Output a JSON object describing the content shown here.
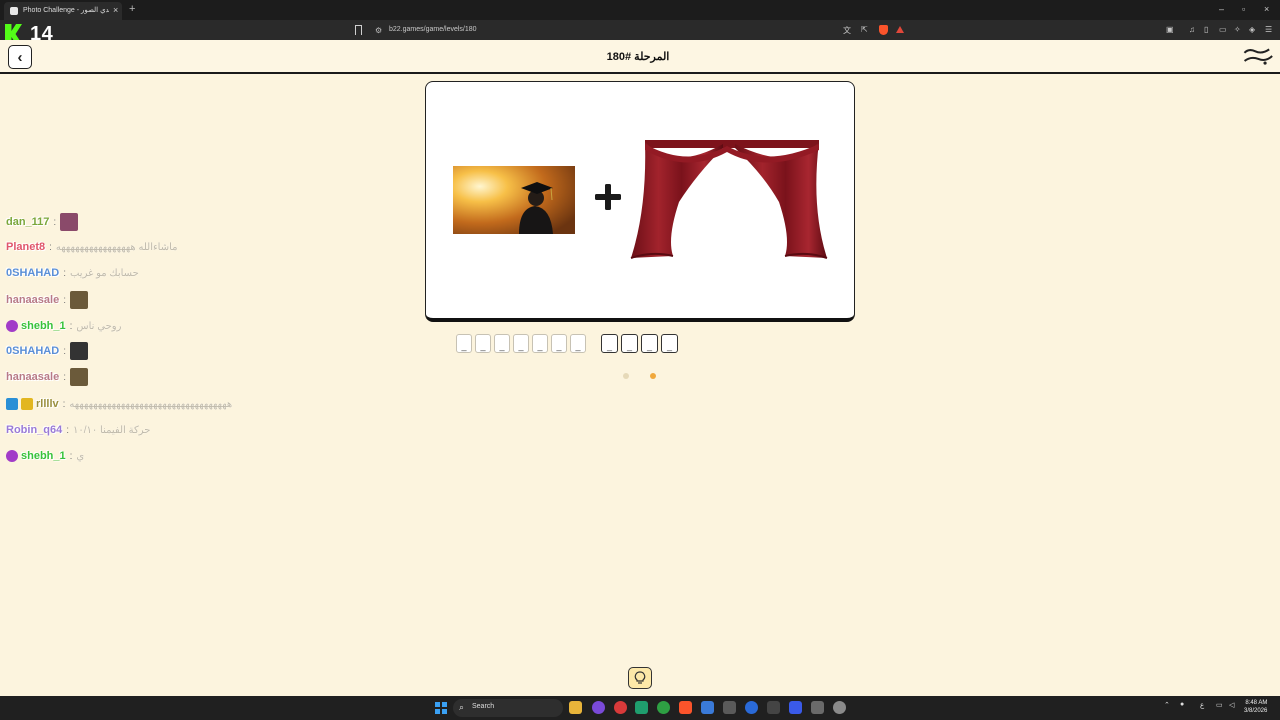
{
  "browser": {
    "tab_title": "Photo Challenge - لعبة تحدي الصور",
    "url": "b22.games/game/levels/180",
    "viewer_count": "14",
    "new_tab": "+",
    "close_tab": "×",
    "minimize": "–",
    "maximize": "▫",
    "close_window": "×"
  },
  "game": {
    "level_title": "المرحلة #180",
    "back_label": "‹",
    "logo_text": "تحدي الصور",
    "clue_images": [
      "graduate-in-cap-at-sunset",
      "red-theater-curtain"
    ],
    "answer_groups": [
      {
        "slots": [
          "_",
          "_",
          "_",
          "_",
          "_",
          "_",
          "_"
        ],
        "style": "empty"
      },
      {
        "slots": [
          "_",
          "_",
          "_",
          "_"
        ],
        "style": "active"
      }
    ],
    "progress_dots": [
      {
        "state": "done",
        "color": "#e6d9b8"
      },
      {
        "state": "current",
        "color": "#f0a83c"
      }
    ]
  },
  "chat": [
    {
      "user": "dan_117",
      "color": "#7aa63a",
      "message": "",
      "avatar": "#8a4a6a"
    },
    {
      "user": "Planet8",
      "color": "#e0566b",
      "message": "ماشاءالله ههههههههههههههههه"
    },
    {
      "user": "0SHAHAD",
      "color": "#5b8fd6",
      "message": "حسابك مو غريب"
    },
    {
      "user": "hanaasale",
      "color": "#b87a86",
      "message": "",
      "avatar": "#6b5a3a"
    },
    {
      "user": "shebh_1",
      "color": "#38c23a",
      "message": "روحي ناس",
      "badge": "#a23cc8"
    },
    {
      "user": "0SHAHAD",
      "color": "#5b8fd6",
      "message": "",
      "avatar": "#333333"
    },
    {
      "user": "hanaasale",
      "color": "#b87a86",
      "message": "",
      "avatar": "#6b5a3a"
    },
    {
      "user": "rllllv",
      "color": "#9a8f3e",
      "message": "ههههههههههههههههههههههههههههههههههه",
      "badge": "#2a8fd6"
    },
    {
      "user": "Robin_q64",
      "color": "#9a7ad6",
      "message": "حركة الفيمنا ١٠/١٠"
    },
    {
      "user": "shebh_1",
      "color": "#38c23a",
      "message": "ي",
      "badge": "#a23cc8"
    }
  ],
  "taskbar": {
    "search_label": "Search",
    "time": "8:48 AM",
    "date": "3/8/2026",
    "lang": "ع"
  },
  "colors": {
    "accent": "#f0a83c",
    "page_bg": "#fcf4de",
    "curtain": "#8e1b24"
  }
}
